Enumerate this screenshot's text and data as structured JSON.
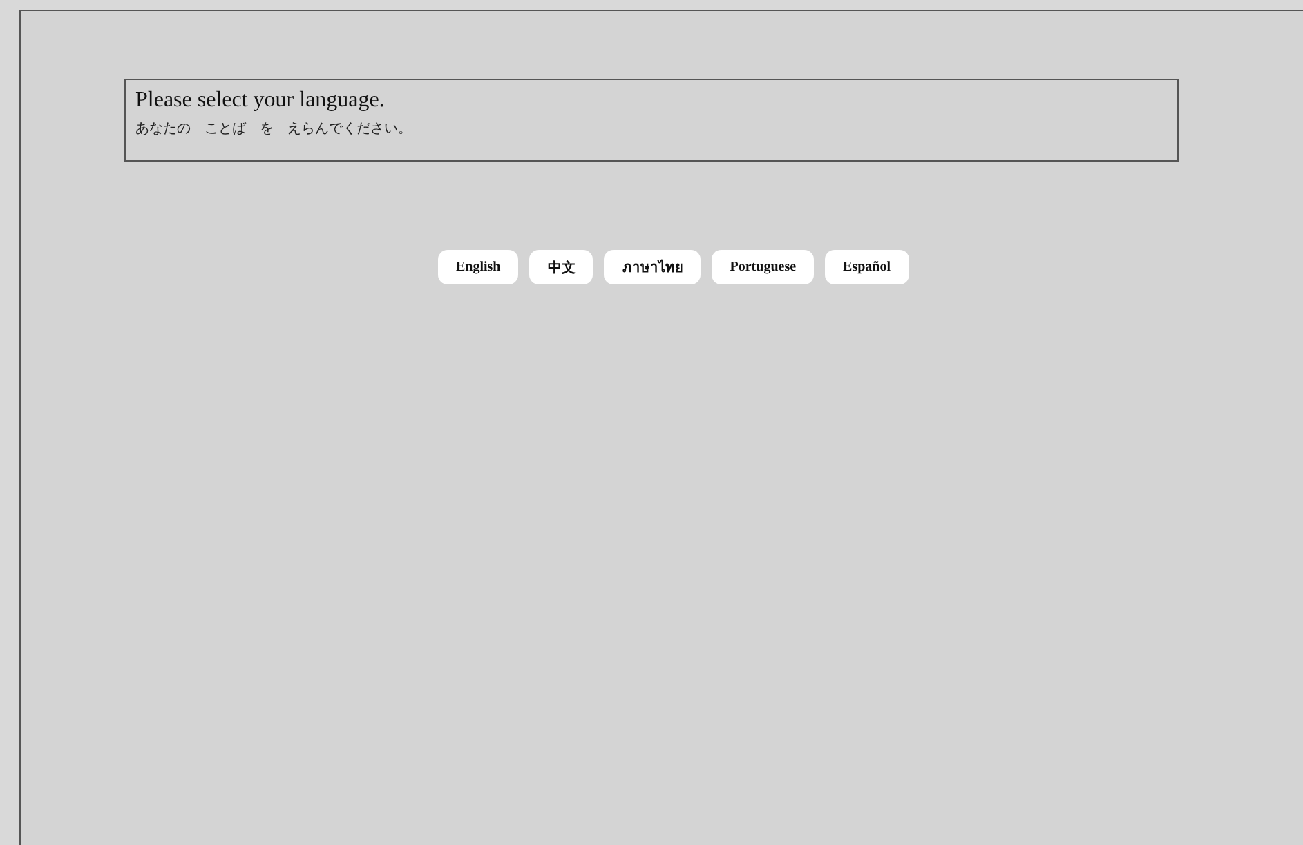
{
  "prompt": {
    "title": "Please select your language.",
    "subtitle": "あなたの　ことば　を　えらんでください。"
  },
  "languages": [
    {
      "label": "English"
    },
    {
      "label": "中文"
    },
    {
      "label": "ภาษาไทย"
    },
    {
      "label": "Portuguese"
    },
    {
      "label": "Español"
    }
  ]
}
